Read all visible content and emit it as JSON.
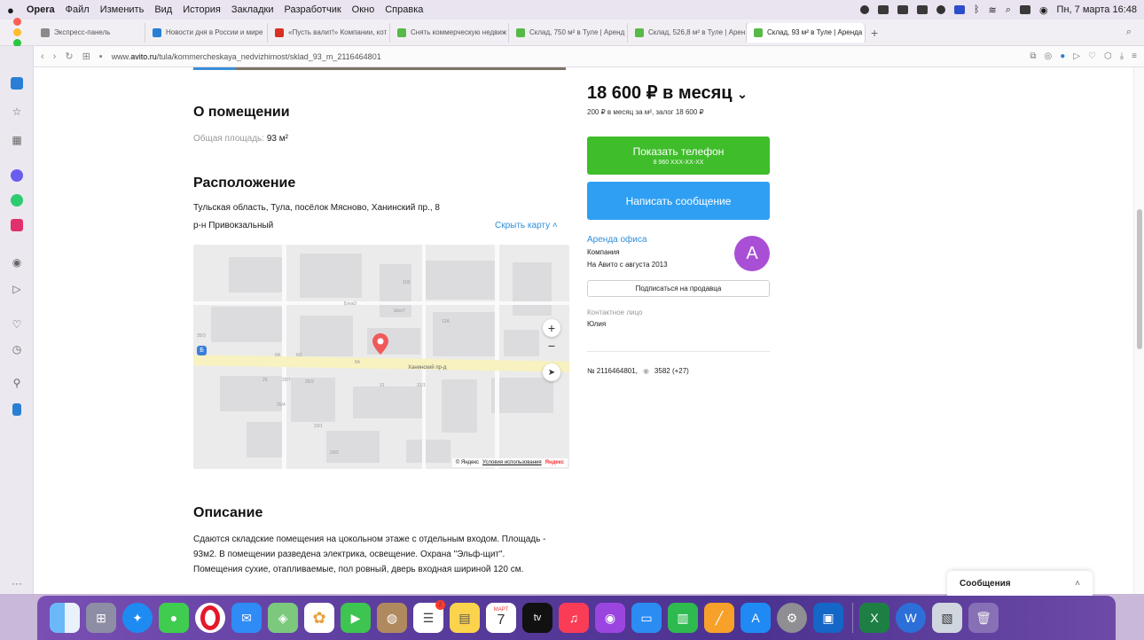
{
  "menubar": {
    "app": "Opera",
    "items": [
      "Файл",
      "Изменить",
      "Вид",
      "История",
      "Закладки",
      "Разработчик",
      "Окно",
      "Справка"
    ],
    "datetime": "Пн, 7 марта 16:48"
  },
  "tabs": [
    {
      "label": "Экспресс-панель",
      "color": "#8a8a8a"
    },
    {
      "label": "Новости дня в России и мире",
      "color": "#2a7fd4"
    },
    {
      "label": "«Пусть валит!» Компании, кот",
      "color": "#d93025"
    },
    {
      "label": "Снять коммерческую недвиж",
      "color": "#57b947"
    },
    {
      "label": "Склад, 750 м² в Туле | Аренд",
      "color": "#57b947"
    },
    {
      "label": "Склад, 526,8 м² в Туле | Арен",
      "color": "#57b947"
    },
    {
      "label": "Склад, 93 м² в Туле | Аренда",
      "color": "#57b947",
      "active": true
    }
  ],
  "address": {
    "prefix": "www.",
    "domain": "avito.ru",
    "path": "/tula/kommercheskaya_nedvizhimost/sklad_93_m_2116464801"
  },
  "listing": {
    "about_title": "О помещении",
    "area_label": "Общая площадь:",
    "area_value": "93 м²",
    "location_title": "Расположение",
    "address": "Тульская область, Тула, посёлок Мясново, Ханинский пр., 8",
    "district": "р-н Привокзальный",
    "hide_map": "Скрыть карту",
    "map": {
      "street_label": "Ханинский пр-д",
      "copyright": "© Яндекс",
      "terms": "Условия использования",
      "brand": "Яндекс",
      "zoom_in": "+",
      "zoom_out": "−",
      "bus_stop": "Б"
    },
    "description_title": "Описание",
    "description_lines": [
      "Сдаются складские помещения на цокольном этаже с отдельным входом. Площадь -",
      "93м2. В помещении разведена электрика, освещение. Охрана \"Эльф-щит\".",
      "Помещения сухие, отапливаемые, пол ровный, дверь входная шириной 120 см."
    ]
  },
  "sidebar_right": {
    "price": "18 600 ₽ в месяц",
    "price_sub": "200 ₽ в месяц за м², залог 18 600 ₽",
    "show_phone": "Показать телефон",
    "phone_masked": "8 960 XXX-XX-XX",
    "write_message": "Написать сообщение",
    "seller_name": "Аренда офиса",
    "seller_type": "Компания",
    "seller_since": "На Авито с августа 2013",
    "avatar_letter": "A",
    "subscribe": "Подписаться на продавца",
    "contact_label": "Контактное лицо",
    "contact_name": "Юлия",
    "ad_number": "№ 2116464801,",
    "views": "3582 (+27)"
  },
  "messages_popup": {
    "title": "Сообщения"
  },
  "colors": {
    "green_button": "#3fbd2b",
    "blue_button": "#2f9ff3",
    "link": "#2f8fda",
    "avatar": "#a94fd5"
  },
  "dock_icons": [
    "finder-icon",
    "launchpad-icon",
    "safari-icon",
    "messages-icon",
    "opera-icon",
    "mail-icon",
    "maps-icon",
    "photos-icon",
    "facetime-icon",
    "contacts-icon",
    "reminders-icon",
    "notes-icon",
    "calendar-icon",
    "tv-icon",
    "music-icon",
    "podcasts-icon",
    "keynote-icon",
    "numbers-icon",
    "pages-icon",
    "appstore-icon",
    "settings-icon",
    "outlook-icon",
    "excel-icon",
    "word-icon",
    "preview-icon",
    "trash-icon"
  ],
  "dock": {
    "calendar_month": "МАРТ",
    "calendar_day": "7",
    "reminders_badge": "2",
    "tv": "tv"
  }
}
